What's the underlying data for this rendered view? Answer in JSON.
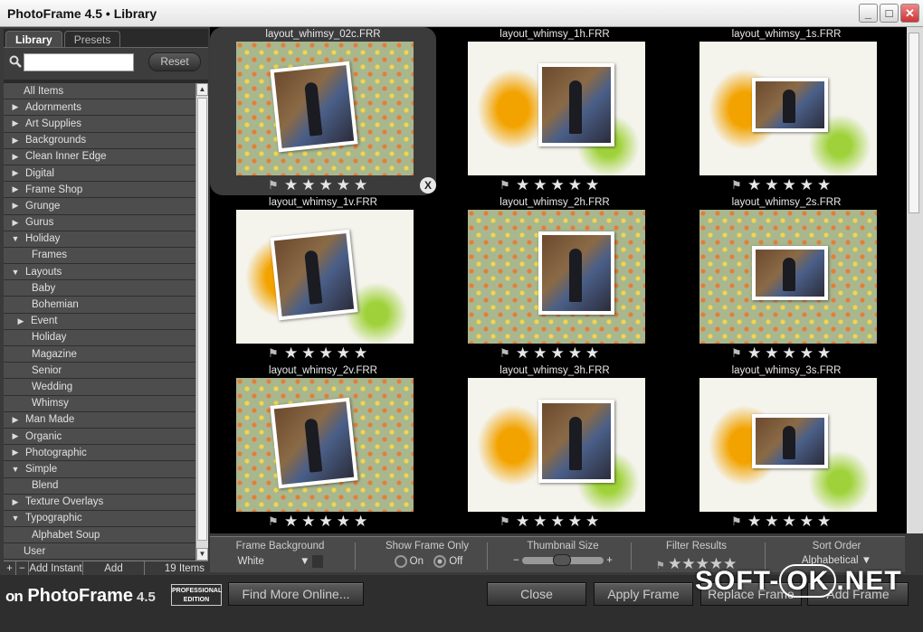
{
  "window": {
    "title": "PhotoFrame 4.5 • Library"
  },
  "sidebar": {
    "tabs": [
      "Library",
      "Presets"
    ],
    "search": {
      "value": "",
      "placeholder": ""
    },
    "reset_label": "Reset",
    "tree": [
      {
        "label": "All Items",
        "level": 0,
        "arrow": ""
      },
      {
        "label": "Adornments",
        "level": 0,
        "arrow": "right"
      },
      {
        "label": "Art Supplies",
        "level": 0,
        "arrow": "right"
      },
      {
        "label": "Backgrounds",
        "level": 0,
        "arrow": "right"
      },
      {
        "label": "Clean Inner Edge",
        "level": 0,
        "arrow": "right"
      },
      {
        "label": "Digital",
        "level": 0,
        "arrow": "right"
      },
      {
        "label": "Frame Shop",
        "level": 0,
        "arrow": "right"
      },
      {
        "label": "Grunge",
        "level": 0,
        "arrow": "right"
      },
      {
        "label": "Gurus",
        "level": 0,
        "arrow": "right"
      },
      {
        "label": "Holiday",
        "level": 0,
        "arrow": "down"
      },
      {
        "label": "Frames",
        "level": 2,
        "arrow": ""
      },
      {
        "label": "Layouts",
        "level": 0,
        "arrow": "down"
      },
      {
        "label": "Baby",
        "level": 2,
        "arrow": ""
      },
      {
        "label": "Bohemian",
        "level": 2,
        "arrow": ""
      },
      {
        "label": "Event",
        "level": 1,
        "arrow": "right"
      },
      {
        "label": "Holiday",
        "level": 2,
        "arrow": ""
      },
      {
        "label": "Magazine",
        "level": 2,
        "arrow": ""
      },
      {
        "label": "Senior",
        "level": 2,
        "arrow": ""
      },
      {
        "label": "Wedding",
        "level": 2,
        "arrow": ""
      },
      {
        "label": "Whimsy",
        "level": 2,
        "arrow": ""
      },
      {
        "label": "Man Made",
        "level": 0,
        "arrow": "right"
      },
      {
        "label": "Organic",
        "level": 0,
        "arrow": "right"
      },
      {
        "label": "Photographic",
        "level": 0,
        "arrow": "right"
      },
      {
        "label": "Simple",
        "level": 0,
        "arrow": "down"
      },
      {
        "label": "Blend",
        "level": 2,
        "arrow": ""
      },
      {
        "label": "Texture Overlays",
        "level": 0,
        "arrow": "right"
      },
      {
        "label": "Typographic",
        "level": 0,
        "arrow": "down"
      },
      {
        "label": "Alphabet Soup",
        "level": 2,
        "arrow": ""
      },
      {
        "label": "User",
        "level": 0,
        "arrow": ""
      }
    ],
    "footer": {
      "plus": "+",
      "minus": "−",
      "add_instant": "Add Instant",
      "add_random": "Add Random",
      "count": "19 Items"
    }
  },
  "grid": {
    "items": [
      {
        "name": "layout_whimsy_02c.FRR",
        "style": "pattern",
        "selected": true
      },
      {
        "name": "layout_whimsy_1h.FRR",
        "style": "white",
        "selected": false
      },
      {
        "name": "layout_whimsy_1s.FRR",
        "style": "white",
        "selected": false
      },
      {
        "name": "layout_whimsy_1v.FRR",
        "style": "white",
        "selected": false
      },
      {
        "name": "layout_whimsy_2h.FRR",
        "style": "pattern",
        "selected": false
      },
      {
        "name": "layout_whimsy_2s.FRR",
        "style": "pattern",
        "selected": false
      },
      {
        "name": "layout_whimsy_2v.FRR",
        "style": "pattern",
        "selected": false
      },
      {
        "name": "layout_whimsy_3h.FRR",
        "style": "white",
        "selected": false
      },
      {
        "name": "layout_whimsy_3s.FRR",
        "style": "white",
        "selected": false
      }
    ],
    "close_glyph": "X"
  },
  "controls": {
    "frame_background": {
      "label": "Frame Background",
      "value": "White"
    },
    "show_frame_only": {
      "label": "Show Frame Only",
      "on": "On",
      "off": "Off",
      "selected": "Off"
    },
    "thumbnail_size": {
      "label": "Thumbnail Size",
      "minus": "−",
      "plus": "+"
    },
    "filter_results": {
      "label": "Filter Results"
    },
    "sort_order": {
      "label": "Sort Order",
      "value": "Alphabetical"
    }
  },
  "footer": {
    "logo_on": "on",
    "logo_name": "PhotoFrame",
    "logo_version": "4.5",
    "edition_badge": "PROFESSIONAL EDITION",
    "find_more": "Find More Online...",
    "close": "Close",
    "apply_frame": "Apply Frame",
    "replace_frame": "Replace Frame",
    "add_frame": "Add Frame"
  },
  "watermark": {
    "left": "SOFT-",
    "ok": "OK",
    "right": ".NET"
  }
}
